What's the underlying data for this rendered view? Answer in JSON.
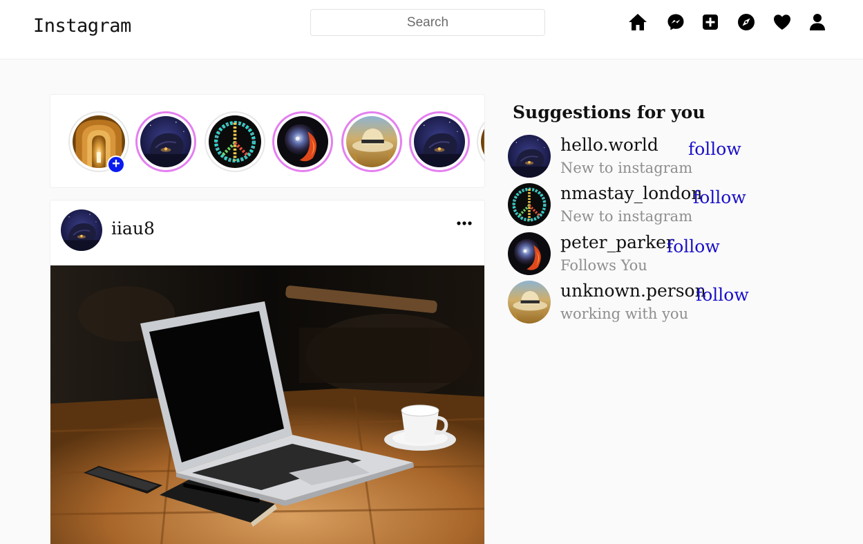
{
  "header": {
    "logo": "Instagram",
    "search_placeholder": "Search",
    "icons": [
      "home-icon",
      "messenger-icon",
      "new-post-icon",
      "explore-icon",
      "activity-heart-icon",
      "profile-icon"
    ]
  },
  "stories": [
    {
      "image": "arches-corridor",
      "type": "own",
      "add_badge": "+"
    },
    {
      "image": "night-rock",
      "type": "unseen"
    },
    {
      "image": "peace-sign",
      "type": "seen"
    },
    {
      "image": "fire-sphere",
      "type": "unseen"
    },
    {
      "image": "straw-hat",
      "type": "unseen"
    },
    {
      "image": "night-rock",
      "type": "unseen"
    },
    {
      "image": "partial",
      "type": "seen"
    }
  ],
  "post": {
    "username": "iiau8",
    "more_icon": "more-dots-icon",
    "image": "laptop-on-table"
  },
  "suggestions": {
    "title": "Suggestions for you",
    "items": [
      {
        "username": "hello.world",
        "subtitle": "New to instagram",
        "action": "follow",
        "image": "night-rock"
      },
      {
        "username": "nmastay_london",
        "subtitle": "New to instagram",
        "action": "follow",
        "image": "peace-sign"
      },
      {
        "username": "peter_parker",
        "subtitle": "Follows You",
        "action": "follow",
        "image": "fire-sphere"
      },
      {
        "username": "unknown.person",
        "subtitle": "working with you",
        "action": "follow",
        "image": "straw-hat"
      }
    ]
  },
  "colors": {
    "story_ring_unseen": "#e47ff0",
    "story_ring_seen": "#e6e6e6",
    "follow_link": "#1a10c8",
    "add_badge": "#0a1cf0",
    "background": "#fafafa"
  }
}
